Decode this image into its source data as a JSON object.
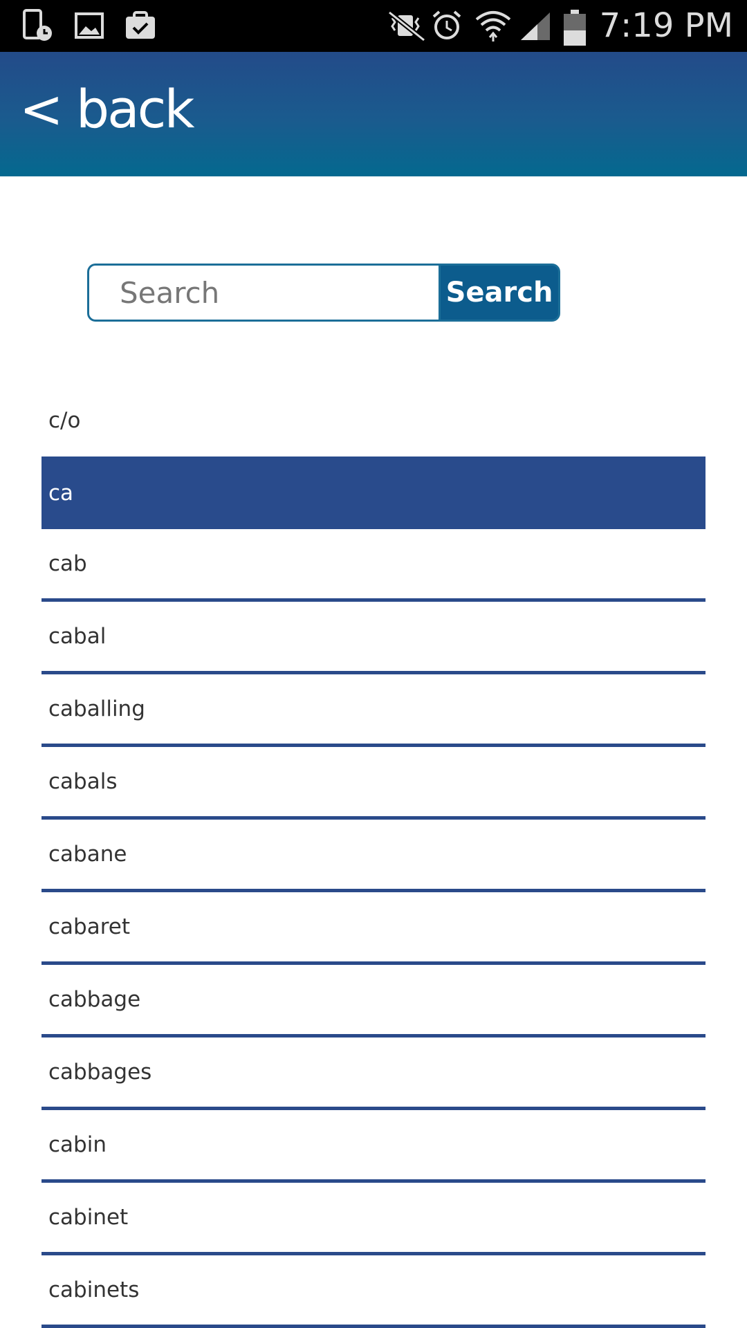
{
  "status_bar": {
    "time": "7:19 PM",
    "icons": [
      "phone-clock-icon",
      "gallery-icon",
      "clipboard-check-icon",
      "mute-vibrate-icon",
      "alarm-icon",
      "wifi-icon",
      "signal-icon",
      "battery-icon"
    ]
  },
  "header": {
    "back_label": "< back",
    "gradient_top": "#234b89",
    "gradient_bottom": "#04698f"
  },
  "search": {
    "placeholder": "Search",
    "value": "",
    "button_label": "Search"
  },
  "word_list": {
    "selected_index": 1,
    "items": [
      "c/o",
      "ca",
      "cab",
      "cabal",
      "caballing",
      "cabals",
      "cabane",
      "cabaret",
      "cabbage",
      "cabbages",
      "cabin",
      "cabinet",
      "cabinets"
    ]
  },
  "colors": {
    "accent": "#294b8c",
    "divider": "#2a4a8a",
    "search_button": "#0c5c8d"
  }
}
